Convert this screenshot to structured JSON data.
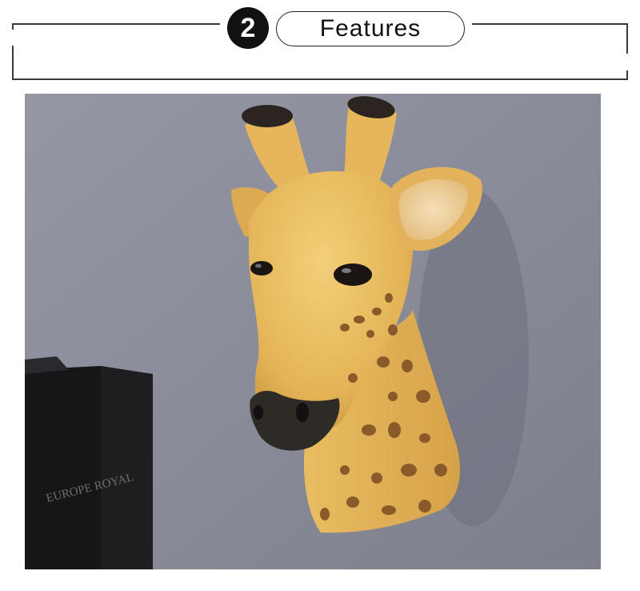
{
  "header": {
    "step_number": "2",
    "title": "Features"
  },
  "photo": {
    "subject": "giraffe-head-wall-sculpture",
    "book_spine_text": "EUROPE ROYAL"
  },
  "colors": {
    "wall": "#8a8c99",
    "giraffe": "#e8b85a",
    "spots": "#8a5a2a",
    "book": "#1b1b1d"
  }
}
